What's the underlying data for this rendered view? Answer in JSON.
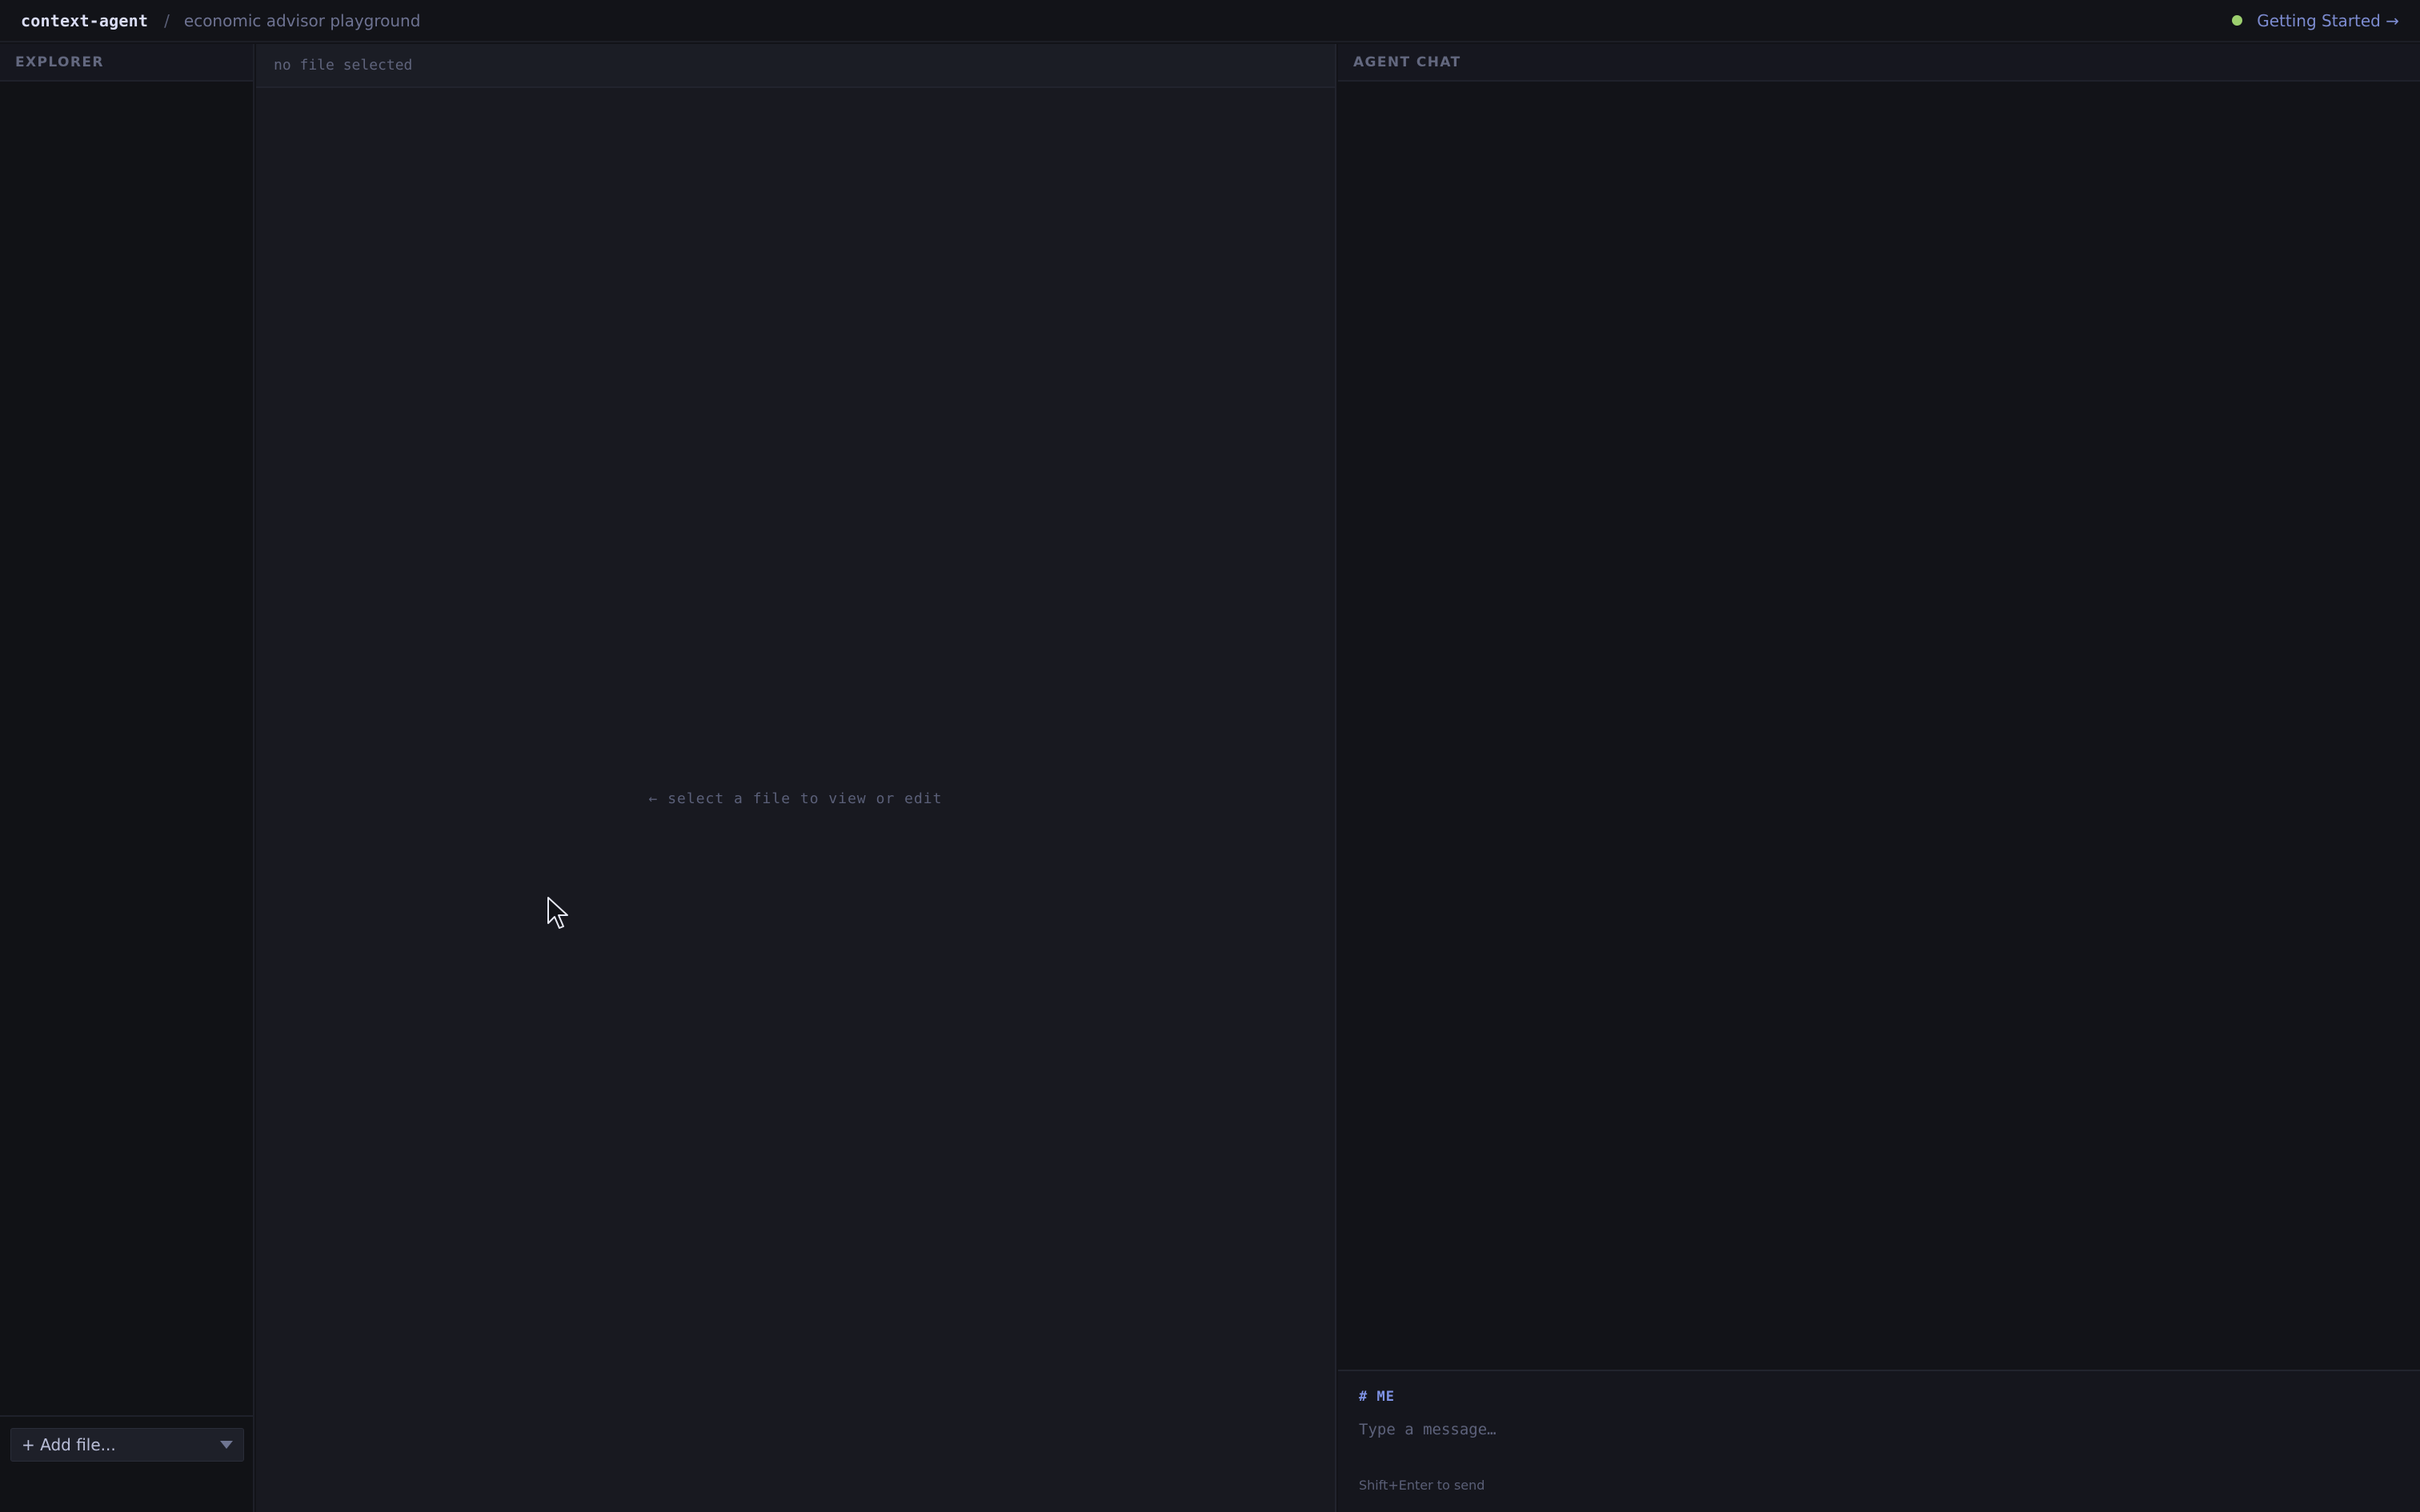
{
  "header": {
    "app_name": "context-agent",
    "separator": "/",
    "project_name": "economic advisor playground",
    "getting_started_label": "Getting Started →",
    "status_color": "#9ccf6e"
  },
  "explorer": {
    "title": "EXPLORER",
    "add_file_label": "+ Add file...",
    "add_file_caret_icon": "caret-down-icon"
  },
  "editor": {
    "title": "no file selected",
    "empty_message": "← select a file to view or edit"
  },
  "chat": {
    "title": "AGENT CHAT",
    "composer_role": "# ME",
    "input_placeholder": "Type a message…",
    "input_value": "",
    "send_hint": "Shift+Enter to send"
  },
  "colors": {
    "accent": "#7c8bd0",
    "role_accent": "#7f93e6",
    "background": "#121318",
    "editor_background": "#181920"
  }
}
